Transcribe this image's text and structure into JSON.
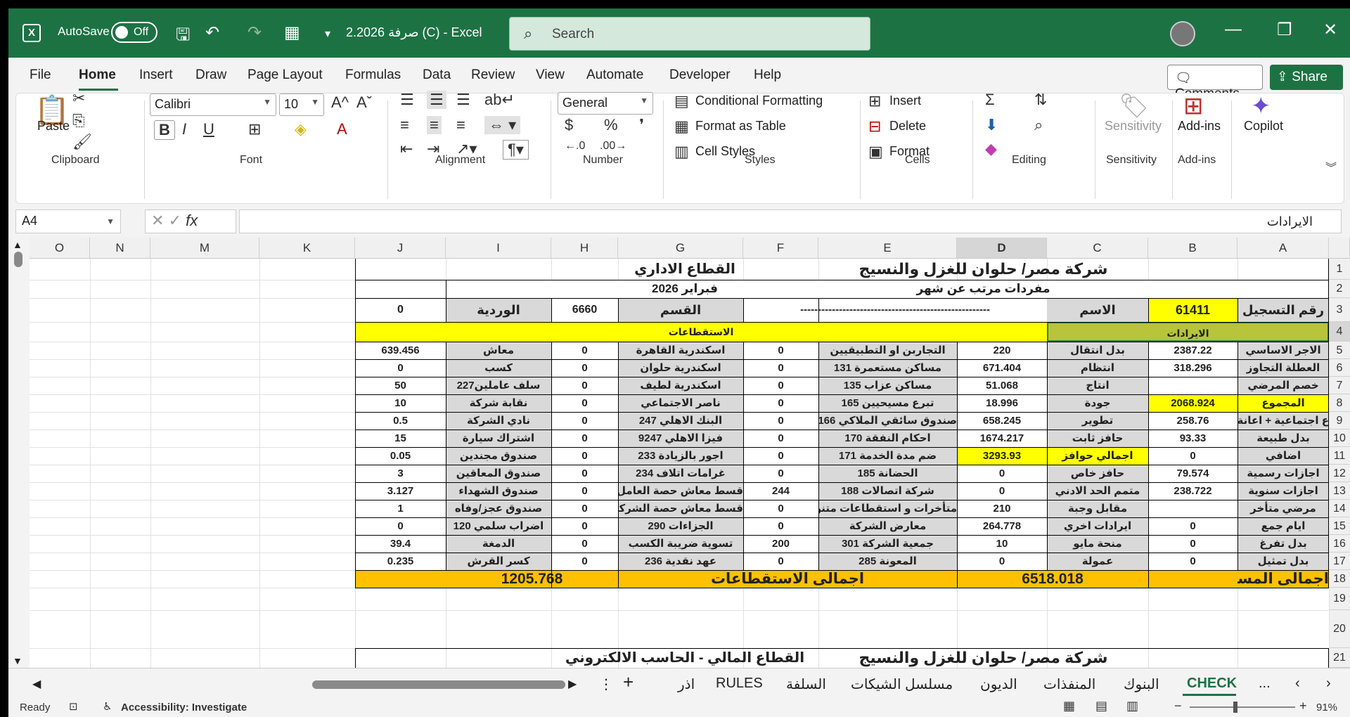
{
  "titlebar": {
    "autosave_label": "AutoSave",
    "autosave_state": "Off",
    "doc_title": "2.2026 صرفة (C)  -  Excel",
    "search_placeholder": "Search"
  },
  "menu": [
    "File",
    "Home",
    "Insert",
    "Draw",
    "Page Layout",
    "Formulas",
    "Data",
    "Review",
    "View",
    "Automate",
    "Developer",
    "Help"
  ],
  "menu_active": "Home",
  "buttons": {
    "comments": "Comments",
    "share": "Share"
  },
  "ribbon": {
    "paste": "Paste",
    "font_name": "Calibri",
    "font_size": "10",
    "number_format": "General",
    "conditional_formatting": "Conditional Formatting",
    "format_as_table": "Format as Table",
    "cell_styles": "Cell Styles",
    "insert": "Insert",
    "delete": "Delete",
    "format": "Format",
    "sensitivity": "Sensitivity",
    "addins": "Add-ins",
    "copilot": "Copilot",
    "groups": {
      "clipboard": "Clipboard",
      "font": "Font",
      "alignment": "Alignment",
      "number": "Number",
      "styles": "Styles",
      "cells": "Cells",
      "editing": "Editing",
      "sensitivity": "Sensitivity",
      "addins": "Add-ins"
    }
  },
  "formula_bar": {
    "name_box": "A4",
    "fx": "fx",
    "content": "الايرادات"
  },
  "columns": [
    "O",
    "N",
    "M",
    "K",
    "J",
    "I",
    "H",
    "G",
    "F",
    "E",
    "D",
    "C",
    "B",
    "A"
  ],
  "rows": [
    "1",
    "2",
    "3",
    "4",
    "5",
    "6",
    "7",
    "8",
    "9",
    "10",
    "11",
    "12",
    "13",
    "14",
    "15",
    "16",
    "17",
    "18",
    "19",
    "20",
    "21"
  ],
  "sheet": {
    "company": "شركة مصر/ حلوان للغزل والنسيج",
    "sector": "القطاع الاداري",
    "subtitle": "مفردات مرتب عن شهر",
    "month": "فبراير 2026",
    "reg_label": "رقم التسجيل",
    "reg_value": "61411",
    "name_label": "الاسم",
    "name_value": "------------------------------------------------------",
    "dept_label": "القسم",
    "dept_value": "6660",
    "shift_label": "الوردية",
    "shift_value": "0",
    "income_header": "الايرادات",
    "deduction_header": "الاستقطاعات",
    "rows": [
      [
        "الاجر الاساسي",
        "2387.22",
        "بدل انتقال",
        "220",
        "التجاربن او التطبيقيين",
        "0",
        "اسكندرية القاهرة",
        "0",
        "معاش",
        "639.456"
      ],
      [
        "العطلة التجاوز",
        "318.296",
        "انتظام",
        "671.404",
        "مساكن مستعمرة 131",
        "0",
        "اسكندرية حلوان",
        "0",
        "كسب",
        "0"
      ],
      [
        "خصم المرضي",
        "",
        "انتاج",
        "51.068",
        "مساكن عزاب 135",
        "0",
        "اسكندرية لطيف",
        "0",
        "سلف عاملين227",
        "50"
      ],
      [
        "المجموع",
        "2068.924",
        "جودة",
        "18.996",
        "تبرع مسيحيين 165",
        "0",
        "ناصر الاجتماعي",
        "0",
        "نقابة شركة",
        "10"
      ],
      [
        "ع اجتماعية + اعانة غلاء",
        "258.76",
        "تطوير",
        "658.245",
        "صندوق سائقي الملاكي 166",
        "0",
        "البنك الاهلي 247",
        "0",
        "نادي الشركة",
        "0.5"
      ],
      [
        "بدل طبيعة",
        "93.33",
        "حافز ثابت",
        "1674.217",
        "احكام النفقة 170",
        "0",
        "فيزا الاهلي 9247",
        "0",
        "اشتراك سيارة",
        "15"
      ],
      [
        "اضافي",
        "0",
        "اجمالي حوافز",
        "3293.93",
        "ضم مدة الخدمة 171",
        "0",
        "اجور بالزيادة 233",
        "0",
        "صندوق مجندين",
        "0.05"
      ],
      [
        "اجازات رسمية",
        "79.574",
        "حافز خاص",
        "0",
        "الحضانة 185",
        "0",
        "غرامات اتلاف 234",
        "0",
        "صندوق المعاقين",
        "3"
      ],
      [
        "اجازات سنوية",
        "238.722",
        "متمم الحد الادني",
        "0",
        "شركة اتصالات 188",
        "244",
        "قسط معاش حصة العامل",
        "0",
        "صندوق الشهداء",
        "3.127"
      ],
      [
        "مرضي متأخر",
        "",
        "مقابل وجبة",
        "210",
        "متأخرات و استقطاعات متنوعة",
        "0",
        "قسط معاش حصة الشركة",
        "0",
        "صندوق عجز/وفاه",
        "1"
      ],
      [
        "ايام جمع",
        "0",
        "ايرادات اخري",
        "264.778",
        "معارض الشركة",
        "0",
        "الجزاءات 290",
        "0",
        "اضراب سلمي 120",
        "0"
      ],
      [
        "بدل تفرغ",
        "0",
        "منحة مايو",
        "10",
        "جمعية الشركة 301",
        "200",
        "تسوية ضريبة الكسب",
        "0",
        "الدمغة",
        "39.4"
      ],
      [
        "بدل تمثيل",
        "0",
        "عمولة",
        "0",
        "المعونة 285",
        "0",
        "عهد نقدية 236",
        "0",
        "كسر القرش",
        "0.235"
      ]
    ],
    "total_due_label": "اجمالى المستحق",
    "total_due_value": "6518.018",
    "total_ded_label": "اجمالى الاستقطاعات",
    "total_ded_value": "1205.768",
    "next_company": "شركة مصر/ حلوان للغزل والنسيج",
    "next_sector": "القطاع المالي - الحاسب الالكتروني"
  },
  "sheet_tabs": [
    "CHECK",
    "البنوك",
    "المنفذات",
    "الديون",
    "مسلسل الشيكات",
    "السلفة",
    "RULES",
    "اذر"
  ],
  "sheet_tabs_more": "...",
  "status": {
    "ready": "Ready",
    "accessibility": "Accessibility: Investigate",
    "zoom": "91%"
  },
  "colors": {
    "excel_green": "#1d7244",
    "yellow": "#ffff00",
    "gold": "#ffc000",
    "olive": "#b8c43a",
    "gray_label": "#d9d9d9"
  }
}
